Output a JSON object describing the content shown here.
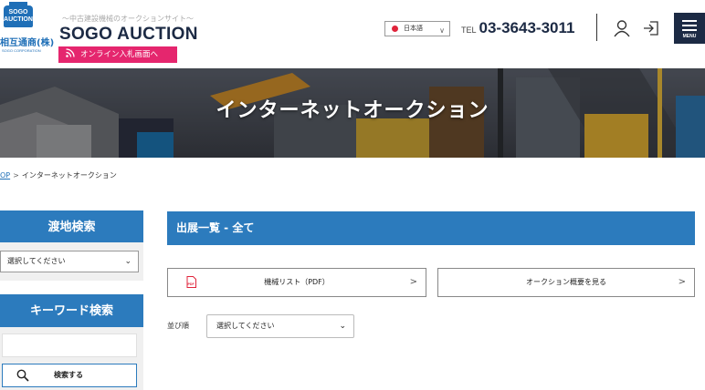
{
  "header": {
    "logo_top": "SOGO AUCTION",
    "logo_company": "相互通商(株)",
    "logo_corp": "SOGO CORPORATION",
    "tagline": "〜中古建設機械のオークションサイト〜",
    "brand": "SOGO AUCTION",
    "online_button": "オンライン入札画面へ",
    "language": "日本語",
    "tel_label": "TEL",
    "tel_number": "03-3643-3011",
    "menu_label": "MENU",
    "icons": [
      "rss-icon",
      "user-icon",
      "login-icon",
      "menu-icon",
      "chevron-down-icon"
    ]
  },
  "hero": {
    "title": "インターネットオークション"
  },
  "breadcrumb": {
    "home": "OP",
    "separator": ">",
    "current": "インターネットオークション"
  },
  "sidebar": {
    "location_heading": "渡地検索",
    "location_select": "選択してください",
    "keyword_heading": "キーワード検索",
    "keyword_placeholder": "",
    "search_button": "検索する"
  },
  "main": {
    "heading": "出展一覧 - 全て",
    "pdf_button": "機械リスト（PDF）",
    "pdf_icon_text": "PDF",
    "overview_button": "オークション概要を見る",
    "chevron": ">",
    "sort_label": "並び順",
    "sort_select": "選択してください"
  },
  "colors": {
    "accent_blue": "#2c7bbd",
    "brand_navy": "#1c2a44",
    "pink": "#e5266e"
  }
}
